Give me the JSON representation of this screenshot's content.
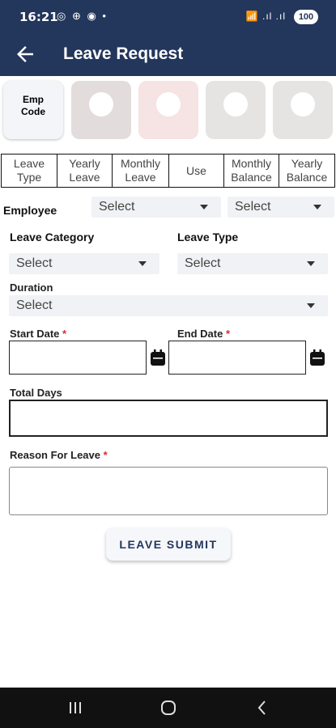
{
  "status": {
    "time": "16:21",
    "notification_icons": "◎ ⊕ ◉ •",
    "system_icons": "📶 .ıl .ıl",
    "battery": "100"
  },
  "appbar": {
    "title": "Leave Request",
    "back_icon": "arrow-left-icon"
  },
  "cards": {
    "emp_code": "Emp\nCode"
  },
  "table_headers": [
    "Leave Type",
    "Yearly Leave",
    "Monthly Leave",
    "Use",
    "Monthly Balance",
    "Yearly Balance"
  ],
  "form": {
    "employee_label": "Employee",
    "employee_select_1": "Select",
    "employee_select_2": "Select",
    "leave_category_label": "Leave Category",
    "leave_category_value": "Select",
    "leave_type_label": "Leave Type",
    "leave_type_value": "Select",
    "duration_label": "Duration",
    "duration_value": "Select",
    "start_date_label": "Start Date",
    "end_date_label": "End Date",
    "required_mark": "*",
    "total_days_label": "Total Days",
    "reason_label": "Reason For Leave",
    "submit_label": "LEAVE SUBMIT"
  },
  "colors": {
    "primary": "#23365c",
    "required": "#d32f2f"
  }
}
